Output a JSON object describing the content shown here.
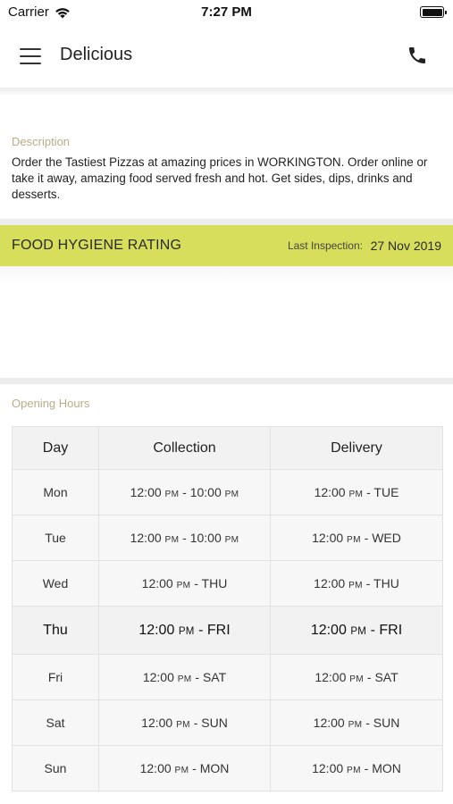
{
  "status_bar": {
    "carrier": "Carrier",
    "time": "7:27 PM"
  },
  "nav": {
    "title": "Delicious",
    "menu_icon": "hamburger-menu-icon",
    "call_icon": "phone-icon"
  },
  "description": {
    "label": "Description",
    "text": "Order the Tastiest Pizzas at amazing prices in WORKINGTON. Order online or take it away, amazing food served fresh and hot. Get sides, dips, drinks and desserts."
  },
  "hygiene": {
    "title": "FOOD HYGIENE RATING",
    "last_inspection_label": "Last Inspection:",
    "last_inspection_date": "27 Nov 2019",
    "bar_color": "#d6de5b"
  },
  "opening_hours": {
    "label": "Opening Hours",
    "headers": [
      "Day",
      "Collection",
      "Delivery"
    ],
    "today": "Thu",
    "rows": [
      {
        "day": "Mon",
        "collection": {
          "from": "12:00",
          "from_ampm": "PM",
          "to": "10:00",
          "to_ampm": "PM"
        },
        "delivery": {
          "from": "12:00",
          "from_ampm": "PM",
          "to": "TUE"
        }
      },
      {
        "day": "Tue",
        "collection": {
          "from": "12:00",
          "from_ampm": "PM",
          "to": "10:00",
          "to_ampm": "PM"
        },
        "delivery": {
          "from": "12:00",
          "from_ampm": "PM",
          "to": "WED"
        }
      },
      {
        "day": "Wed",
        "collection": {
          "from": "12:00",
          "from_ampm": "PM",
          "to": "THU"
        },
        "delivery": {
          "from": "12:00",
          "from_ampm": "PM",
          "to": "THU"
        }
      },
      {
        "day": "Thu",
        "collection": {
          "from": "12:00",
          "from_ampm": "PM",
          "to": "FRI"
        },
        "delivery": {
          "from": "12:00",
          "from_ampm": "PM",
          "to": "FRI"
        }
      },
      {
        "day": "Fri",
        "collection": {
          "from": "12:00",
          "from_ampm": "PM",
          "to": "SAT"
        },
        "delivery": {
          "from": "12:00",
          "from_ampm": "PM",
          "to": "SAT"
        }
      },
      {
        "day": "Sat",
        "collection": {
          "from": "12:00",
          "from_ampm": "PM",
          "to": "SUN"
        },
        "delivery": {
          "from": "12:00",
          "from_ampm": "PM",
          "to": "SUN"
        }
      },
      {
        "day": "Sun",
        "collection": {
          "from": "12:00",
          "from_ampm": "PM",
          "to": "MON"
        },
        "delivery": {
          "from": "12:00",
          "from_ampm": "PM",
          "to": "MON"
        }
      }
    ]
  }
}
